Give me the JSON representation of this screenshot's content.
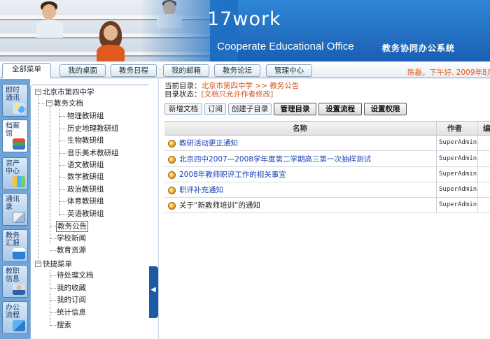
{
  "banner": {
    "logo": "17work",
    "subtitle": "Cooperate Educational Office",
    "subtitle_cn": "教务协同办公系统"
  },
  "topnav": {
    "tabs": [
      {
        "label": "全部菜单",
        "active": true
      },
      {
        "label": "我的桌面"
      },
      {
        "label": "教务日程"
      },
      {
        "label": "我的邮箱"
      },
      {
        "label": "教务论坛"
      },
      {
        "label": "管理中心"
      }
    ],
    "user_info": "陈磊，下午好.  2009年8月"
  },
  "left_tabs": [
    {
      "label": "即时通讯",
      "icon": "people-icon"
    },
    {
      "label": "档案馆",
      "icon": "books-icon",
      "active": true
    },
    {
      "label": "资产中心",
      "icon": "chart-icon"
    },
    {
      "label": "通讯录",
      "icon": "address-book-icon"
    },
    {
      "label": "教务汇报",
      "icon": "report-icon"
    },
    {
      "label": "教职信息",
      "icon": "teacher-info-icon"
    },
    {
      "label": "办公流程",
      "icon": "workflow-icon"
    }
  ],
  "tree": {
    "root": "北京市第四中学",
    "docs": "教务文档",
    "groups": [
      "物理教研组",
      "历史地理教研组",
      "生物教研组",
      "音乐美术教研组",
      "语文教研组",
      "数学教研组",
      "政治教研组",
      "体育教研组",
      "英语教研组"
    ],
    "others": [
      "教务公告",
      "学校新闻",
      "教育资源"
    ],
    "shortcut": "快捷菜单",
    "shortcut_items": [
      "待处理文档",
      "我的收藏",
      "我的订阅",
      "统计信息",
      "搜索"
    ]
  },
  "path": {
    "label": "当前目录：",
    "school": "北京市第四中学",
    "sep": ">>",
    "folder": "教务公告",
    "status_label": "目录状态：",
    "status_value": "[文档只允许作者修改]"
  },
  "toolbar": {
    "new_doc": "新增文档",
    "subscribe": "订阅",
    "create_subdir": "创建子目录",
    "manage_dir": "管理目录",
    "set_flow": "设置流程",
    "set_perm": "设置权限"
  },
  "grid": {
    "col_name": "名称",
    "col_author": "作者",
    "col_extra": "编",
    "rows": [
      {
        "title": "教研活动更正通知",
        "author": "SuperAdmin",
        "link": true
      },
      {
        "title": "北京四中2007—2008学年度第二学期高三第一次抽样测试",
        "author": "SuperAdmin",
        "link": true
      },
      {
        "title": "2008年教师职评工作的相关事宜",
        "author": "SuperAdmin",
        "link": true
      },
      {
        "title": "职评补充通知",
        "author": "SuperAdmin",
        "link": true
      },
      {
        "title": "关于“新教师培训”的通知",
        "author": "SuperAdmin",
        "link": false
      }
    ]
  }
}
